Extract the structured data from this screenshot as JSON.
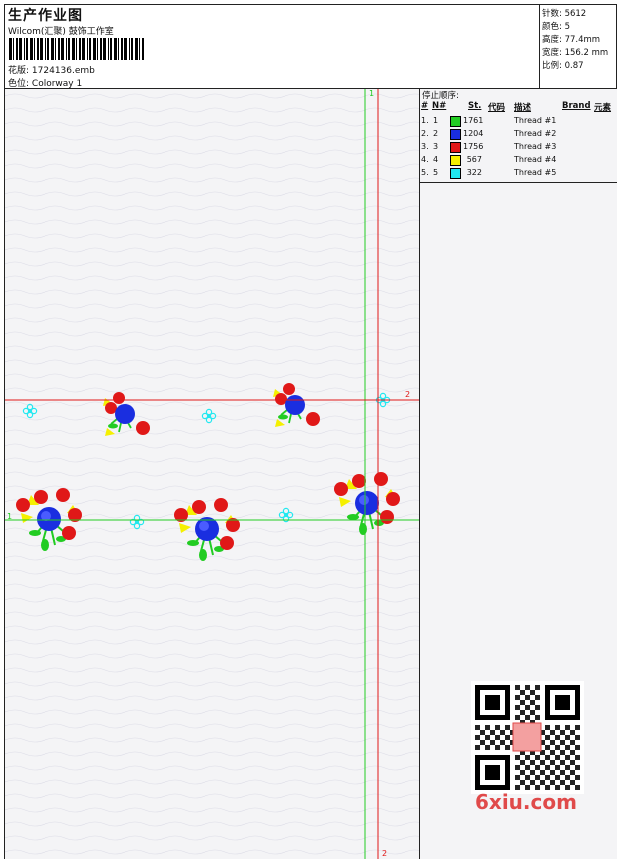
{
  "header": {
    "title": "生产作业图",
    "company": "Wilcom(汇聚) 鼓饰工作室",
    "design_label": "花版:",
    "design_value": "1724136.emb",
    "colorway_label": "色位:",
    "colorway_value": "Colorway 1"
  },
  "stats": [
    {
      "label": "针数:",
      "value": "5612"
    },
    {
      "label": "颜色:",
      "value": "5"
    },
    {
      "label": "高度:",
      "value": "77.4mm"
    },
    {
      "label": "宽度:",
      "value": "156.2 mm"
    },
    {
      "label": "比例:",
      "value": "0.87"
    }
  ],
  "stop_sequence": {
    "title": "停止顺序:",
    "columns": [
      "#",
      "N#",
      "St.",
      "代码",
      "描述",
      "Brand",
      "元素"
    ],
    "rows": [
      {
        "seq": "1.",
        "n": "1",
        "st": "1761",
        "desc": "Thread #1",
        "color": "#22cc22"
      },
      {
        "seq": "2.",
        "n": "2",
        "st": "1204",
        "desc": "Thread #2",
        "color": "#1a2ee0"
      },
      {
        "seq": "3.",
        "n": "3",
        "st": "1756",
        "desc": "Thread #3",
        "color": "#e01818"
      },
      {
        "seq": "4.",
        "n": "4",
        "st": "567",
        "desc": "Thread #4",
        "color": "#f5f000"
      },
      {
        "seq": "5.",
        "n": "5",
        "st": "322",
        "desc": "Thread #5",
        "color": "#22e8f0"
      }
    ]
  },
  "canvas": {
    "guide_labels": {
      "green_top": "1",
      "green_left": "1",
      "red_right": "2",
      "red_bottom": "2"
    },
    "colors": {
      "guide_green": "#22cc22",
      "guide_red": "#e01818",
      "background": "#f4f4f6"
    }
  },
  "watermark": {
    "text": "6xiu.com"
  },
  "icons": {
    "qr": "qr-code-icon",
    "barcode": "barcode-icon"
  }
}
